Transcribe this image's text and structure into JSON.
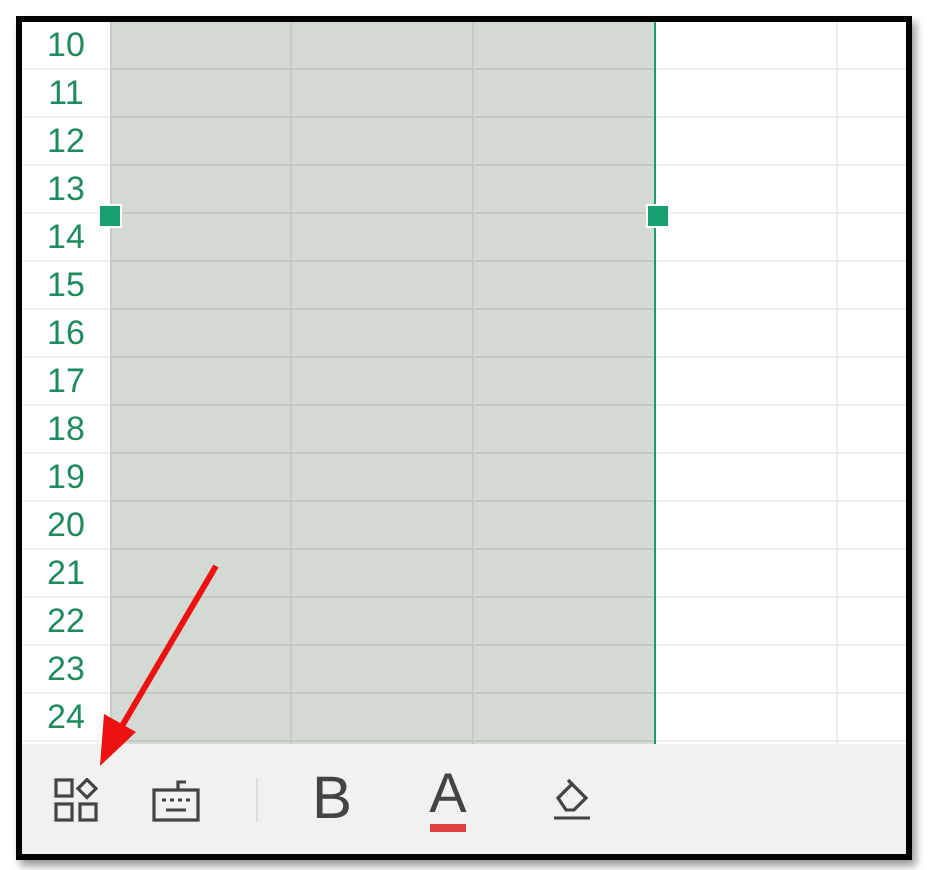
{
  "rows": [
    "10",
    "11",
    "12",
    "13",
    "14",
    "15",
    "16",
    "17",
    "18",
    "19",
    "20",
    "21",
    "22",
    "23",
    "24"
  ],
  "columns": [
    {
      "selected": true
    },
    {
      "selected": true
    },
    {
      "selected": true
    },
    {
      "selected": false
    },
    {
      "selected": false
    }
  ],
  "toolbar": [
    {
      "kind": "apps"
    },
    {
      "kind": "keyboard"
    },
    {
      "kind": "divider"
    },
    {
      "kind": "bold",
      "label": "B"
    },
    {
      "kind": "color",
      "label": "A"
    },
    {
      "kind": "fill"
    }
  ]
}
